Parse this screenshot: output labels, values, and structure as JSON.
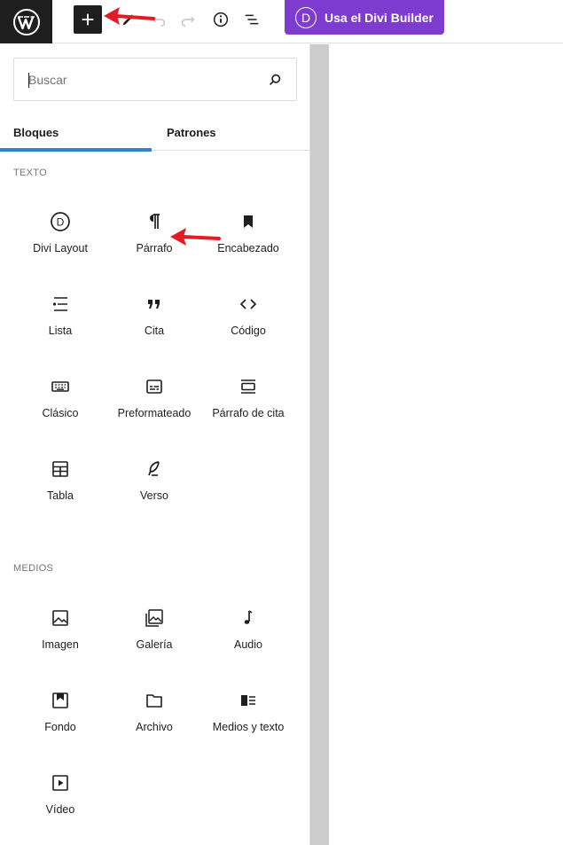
{
  "toolbar": {
    "divi_button_label": "Usa el Divi Builder",
    "divi_badge": "D"
  },
  "inserter": {
    "search_placeholder": "Buscar",
    "tabs": [
      {
        "label": "Bloques",
        "active": true
      },
      {
        "label": "Patrones",
        "active": false
      }
    ],
    "categories": [
      {
        "title": "TEXTO",
        "blocks": [
          {
            "label": "Divi Layout",
            "icon": "divi-icon"
          },
          {
            "label": "Párrafo",
            "icon": "paragraph-icon"
          },
          {
            "label": "Encabezado",
            "icon": "bookmark-icon"
          },
          {
            "label": "Lista",
            "icon": "list-icon"
          },
          {
            "label": "Cita",
            "icon": "quote-icon"
          },
          {
            "label": "Código",
            "icon": "code-icon"
          },
          {
            "label": "Clásico",
            "icon": "keyboard-icon"
          },
          {
            "label": "Preformateado",
            "icon": "preformatted-icon"
          },
          {
            "label": "Párrafo de cita",
            "icon": "pullquote-icon"
          },
          {
            "label": "Tabla",
            "icon": "table-icon"
          },
          {
            "label": "Verso",
            "icon": "feather-icon"
          }
        ]
      },
      {
        "title": "MEDIOS",
        "blocks": [
          {
            "label": "Imagen",
            "icon": "image-icon"
          },
          {
            "label": "Galería",
            "icon": "gallery-icon"
          },
          {
            "label": "Audio",
            "icon": "audio-icon"
          },
          {
            "label": "Fondo",
            "icon": "cover-icon"
          },
          {
            "label": "Archivo",
            "icon": "folder-icon"
          },
          {
            "label": "Medios y texto",
            "icon": "media-text-icon"
          },
          {
            "label": "Vídeo",
            "icon": "video-icon"
          }
        ]
      }
    ]
  },
  "colors": {
    "accent_tab": "#3582c4",
    "divi_purple": "#7e3bd0",
    "annotation_arrow": "#e31b23"
  }
}
